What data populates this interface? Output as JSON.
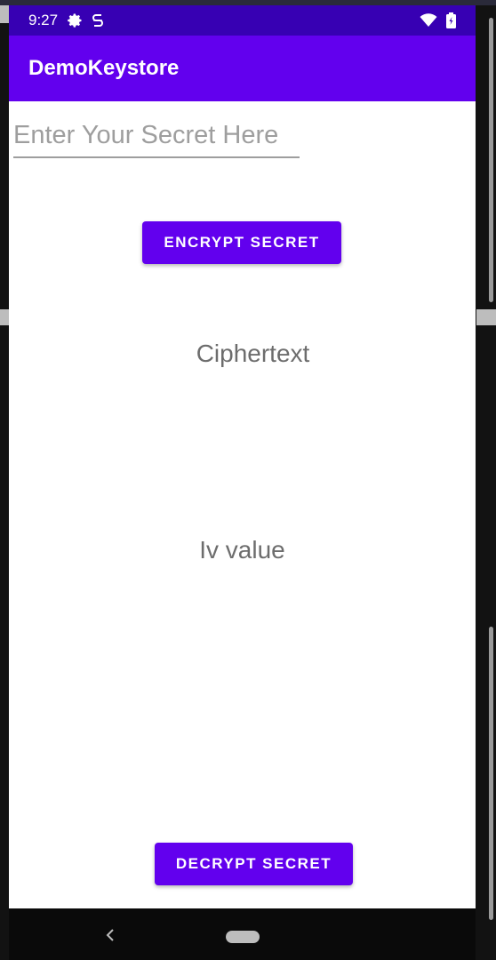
{
  "status_bar": {
    "time": "9:27",
    "icons": [
      "gear-icon",
      "s-icon",
      "wifi-icon",
      "battery-icon"
    ]
  },
  "app_bar": {
    "title": "DemoKeystore"
  },
  "secret_input": {
    "placeholder": "Enter Your Secret Here",
    "value": ""
  },
  "encrypt_button": {
    "label": "ENCRYPT SECRET"
  },
  "ciphertext_label": "Ciphertext",
  "iv_label": "Iv value",
  "decrypt_button": {
    "label": "DECRYPT SECRET"
  },
  "nav_bar": {
    "icons": [
      "back-icon",
      "home-pill-icon"
    ]
  },
  "colors": {
    "status_bar": "#3700b3",
    "primary": "#6200ee",
    "text_muted": "#6d6d6d"
  }
}
